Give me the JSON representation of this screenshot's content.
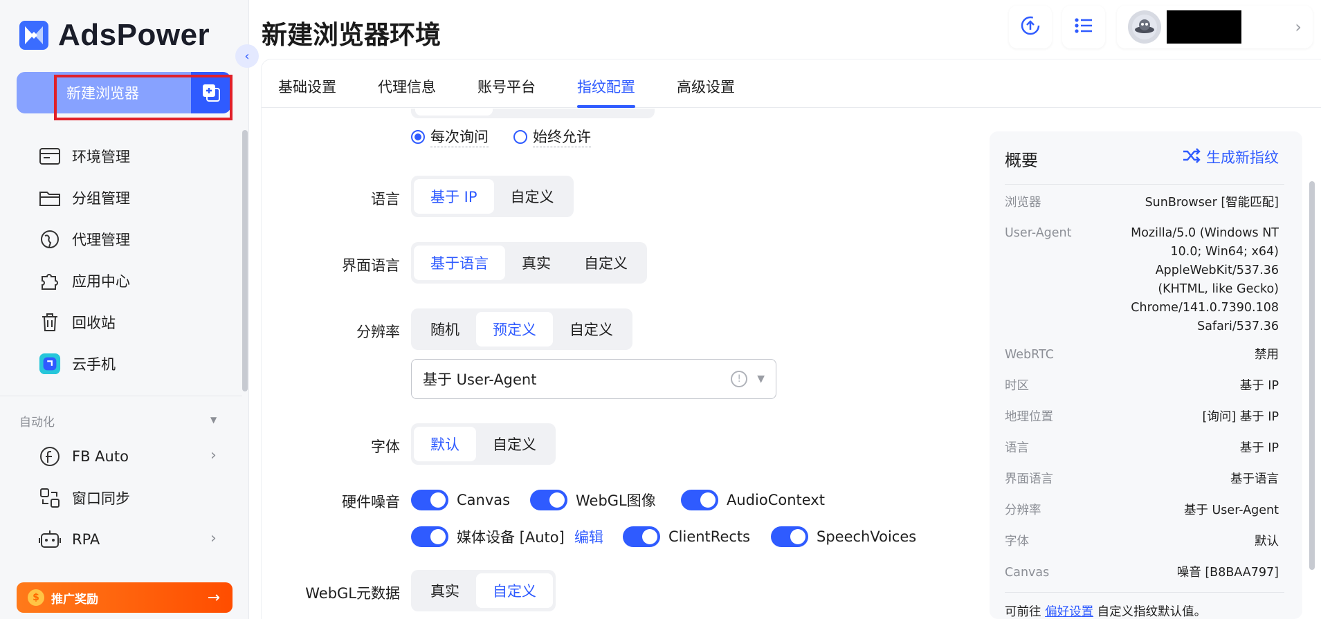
{
  "app": {
    "name": "AdsPower"
  },
  "sidebar": {
    "new_browser_label": "新建浏览器",
    "nav": [
      {
        "label": "环境管理",
        "icon": "browser-window-icon"
      },
      {
        "label": "分组管理",
        "icon": "folder-icon"
      },
      {
        "label": "代理管理",
        "icon": "proxy-icon"
      },
      {
        "label": "应用中心",
        "icon": "puzzle-icon"
      },
      {
        "label": "回收站",
        "icon": "trash-icon"
      },
      {
        "label": "云手机",
        "icon": "cloud-phone-icon"
      }
    ],
    "automation_title": "自动化",
    "automation": [
      {
        "label": "FB Auto",
        "icon": "facebook-icon"
      },
      {
        "label": "窗口同步",
        "icon": "window-sync-icon"
      },
      {
        "label": "RPA",
        "icon": "robot-icon"
      }
    ],
    "promo_label": "推广奖励"
  },
  "header": {
    "title": "新建浏览器环境"
  },
  "tabs": [
    "基础设置",
    "代理信息",
    "账号平台",
    "指纹配置",
    "高级设置"
  ],
  "active_tab": "指纹配置",
  "form": {
    "location_options": [
      "每次询问",
      "始终允许"
    ],
    "language": {
      "label": "语言",
      "options": [
        "基于 IP",
        "自定义"
      ],
      "selected": "基于 IP"
    },
    "ui_language": {
      "label": "界面语言",
      "options": [
        "基于语言",
        "真实",
        "自定义"
      ],
      "selected": "基于语言"
    },
    "resolution": {
      "label": "分辨率",
      "options": [
        "随机",
        "预定义",
        "自定义"
      ],
      "selected": "预定义",
      "select_value": "基于 User-Agent"
    },
    "font": {
      "label": "字体",
      "options": [
        "默认",
        "自定义"
      ],
      "selected": "默认"
    },
    "hardware_noise": {
      "label": "硬件噪音",
      "items": [
        "Canvas",
        "WebGL图像",
        "AudioContext",
        "媒体设备 [Auto]",
        "ClientRects",
        "SpeechVoices"
      ],
      "edit_label": "编辑"
    },
    "webgl_meta": {
      "label": "WebGL元数据",
      "options": [
        "真实",
        "自定义"
      ],
      "selected": "自定义"
    }
  },
  "overview": {
    "title": "概要",
    "generate_label": "生成新指纹",
    "rows": [
      {
        "key": "浏览器",
        "value": "SunBrowser [智能匹配]"
      },
      {
        "key": "User-Agent",
        "value": "Mozilla/5.0 (Windows NT 10.0; Win64; x64) AppleWebKit/537.36 (KHTML, like Gecko) Chrome/141.0.7390.108 Safari/537.36"
      },
      {
        "key": "WebRTC",
        "value": "禁用"
      },
      {
        "key": "时区",
        "value": "基于 IP"
      },
      {
        "key": "地理位置",
        "value": "[询问] 基于 IP"
      },
      {
        "key": "语言",
        "value": "基于 IP"
      },
      {
        "key": "界面语言",
        "value": "基于语言"
      },
      {
        "key": "分辨率",
        "value": "基于 User-Agent"
      },
      {
        "key": "字体",
        "value": "默认"
      },
      {
        "key": "Canvas",
        "value": "噪音 [B8BAA797]"
      }
    ],
    "footer_prefix": "可前往",
    "footer_link": "偏好设置",
    "footer_suffix": "自定义指纹默认值。"
  },
  "colors": {
    "accent": "#2f5bff",
    "highlight": "#e0202a",
    "promo": "#ff5a00"
  }
}
